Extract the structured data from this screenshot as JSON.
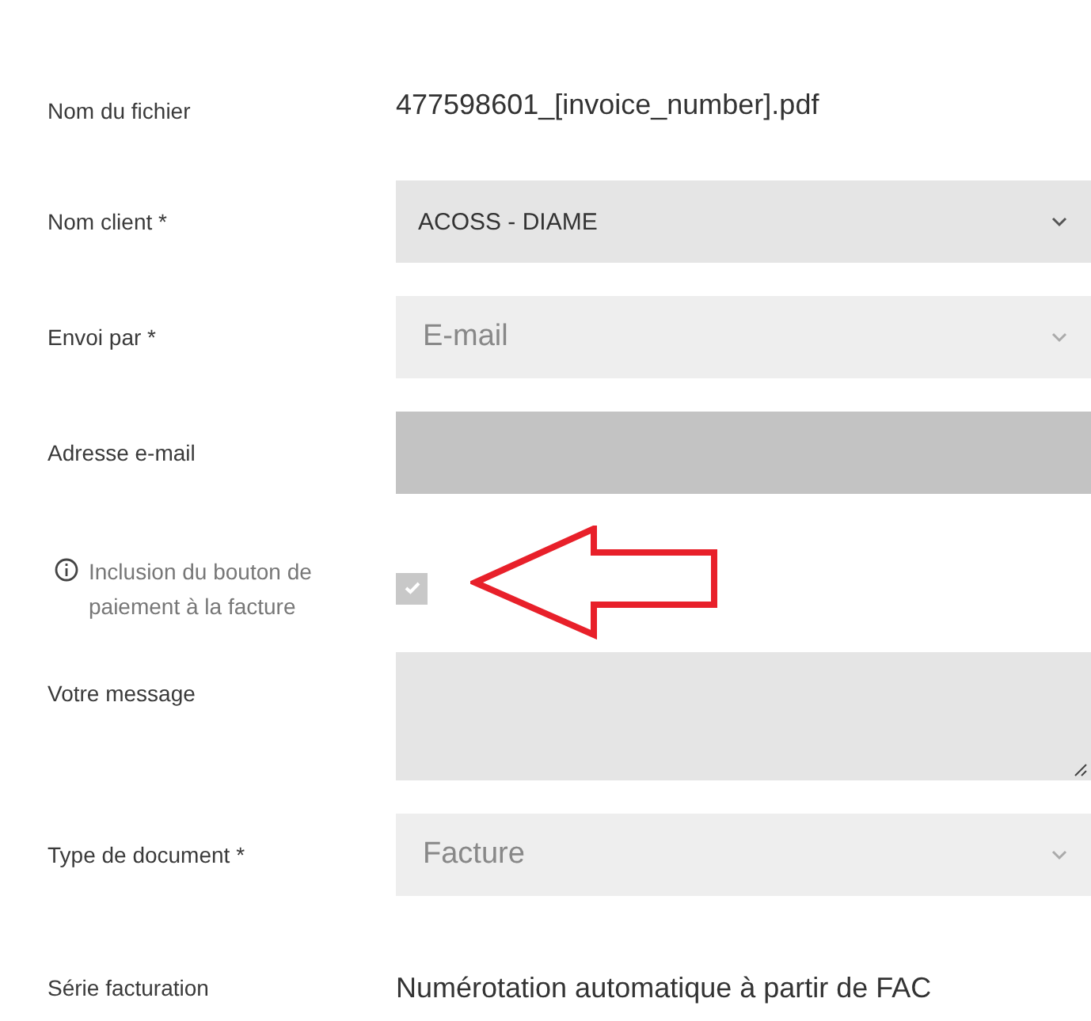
{
  "fields": [
    {
      "kind": "text",
      "label": "Nom du fichier",
      "value": "477598601_[invoice_number].pdf"
    },
    {
      "kind": "select",
      "label": "Nom client *",
      "value": "ACOSS - DIAME",
      "disabled": false
    },
    {
      "kind": "select",
      "label": "Envoi par *",
      "value": "E-mail",
      "disabled": true
    },
    {
      "kind": "input",
      "label": "Adresse e-mail",
      "disabled": true
    },
    {
      "kind": "checkbox",
      "label": "Inclusion du bouton de paiement à la facture",
      "checked": true,
      "disabled": true
    },
    {
      "kind": "textarea",
      "label": "Votre message"
    },
    {
      "kind": "select",
      "label": "Type de document *",
      "value": "Facture",
      "disabled": true
    },
    {
      "kind": "text",
      "label": "Série facturation",
      "value": "Numérotation automatique à partir de FAC"
    }
  ]
}
